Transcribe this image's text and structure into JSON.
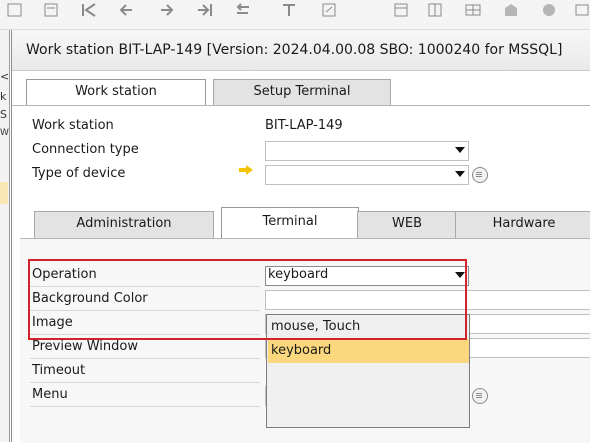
{
  "window": {
    "title": "Work station BIT-LAP-149 [Version: 2024.04.00.08 SBO: 1000240 for MSSQL]"
  },
  "background_window": {
    "stubs": [
      "<",
      "k",
      "S",
      "W"
    ]
  },
  "top_tabs": [
    {
      "label": "Work station",
      "active": true
    },
    {
      "label": "Setup Terminal",
      "active": false
    }
  ],
  "header_fields": [
    {
      "label": "Work station",
      "value": "BIT-LAP-149"
    },
    {
      "label": "Connection type",
      "value": ""
    },
    {
      "label": "Type of device",
      "value": ""
    }
  ],
  "sub_tabs": [
    {
      "label": "Administration",
      "active": false
    },
    {
      "label": "Terminal",
      "active": true
    },
    {
      "label": "WEB",
      "active": false
    },
    {
      "label": "Hardware",
      "active": false
    }
  ],
  "terminal_fields": [
    {
      "label": "Operation",
      "value": "keyboard"
    },
    {
      "label": "Background Color",
      "value": ""
    },
    {
      "label": "Image",
      "value": ""
    },
    {
      "label": "Preview Window",
      "value": ""
    },
    {
      "label": "Timeout",
      "value": ""
    },
    {
      "label": "Menu",
      "value": ""
    }
  ],
  "operation_dropdown": {
    "options": [
      "mouse, Touch",
      "keyboard"
    ],
    "selected": "keyboard"
  },
  "colors": {
    "highlight": "#fbd77d",
    "annotation_red": "#d1232a",
    "arrow_yellow": "#f5c400"
  },
  "icons": {
    "toolbar": [
      "first-record-icon",
      "previous-record-icon",
      "back-icon",
      "forward-icon",
      "last-record-icon",
      "refresh-icon",
      "filter-icon",
      "document-icon",
      "copy-icon",
      "paste-icon",
      "table-icon",
      "layout-icon",
      "settings-icon"
    ],
    "field": [
      "info-menu-icon",
      "yellow-arrow-icon",
      "dropdown-arrow-icon"
    ]
  }
}
